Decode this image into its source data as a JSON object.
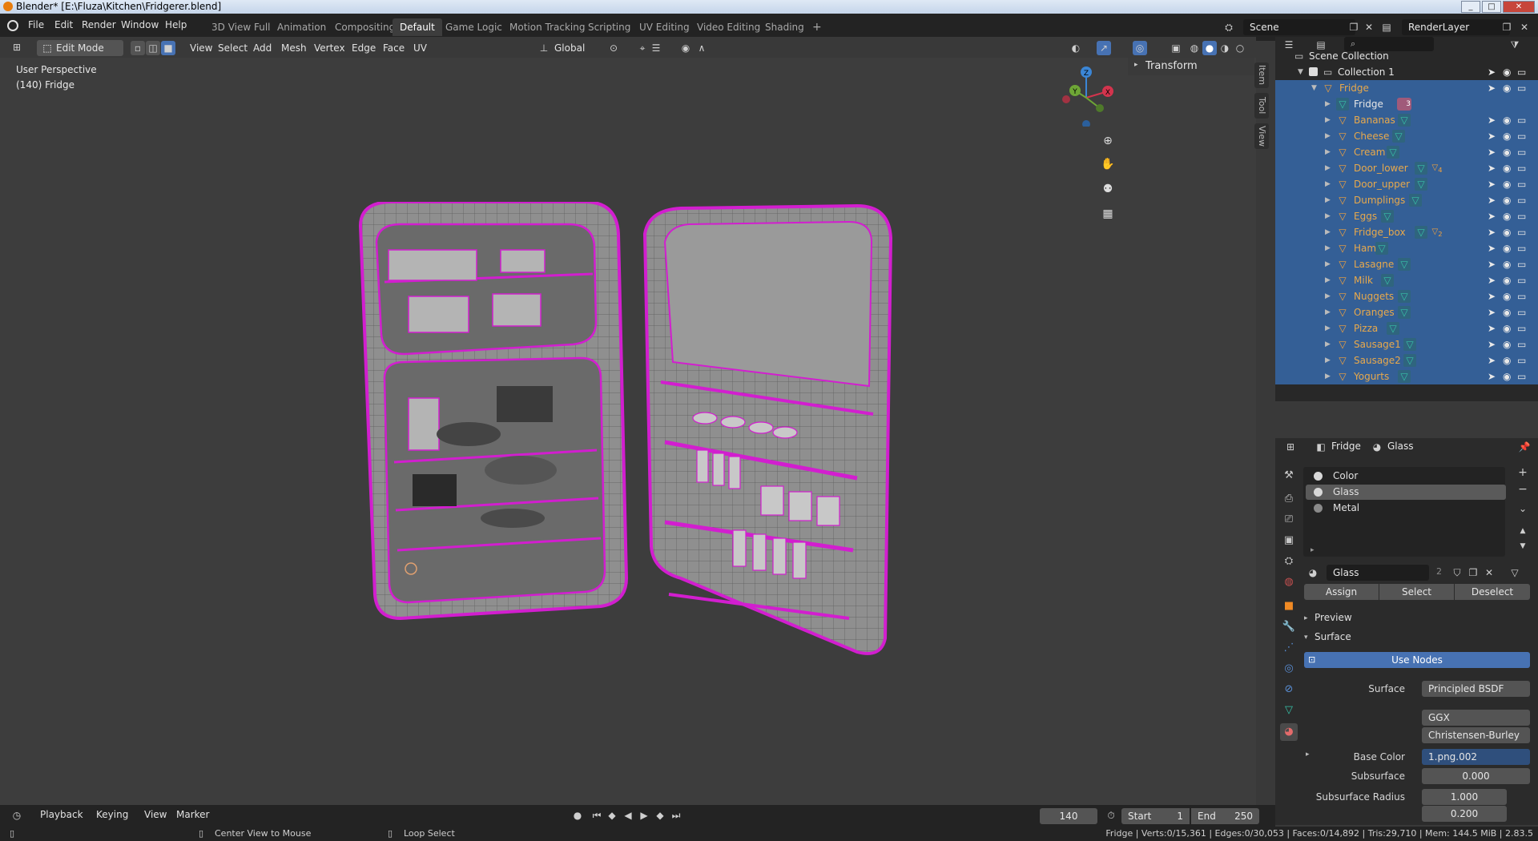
{
  "window": {
    "title": "Blender* [E:\\Fluza\\Kitchen\\Fridgerer.blend]",
    "min": "_",
    "max": "□",
    "close": "✕"
  },
  "menu": [
    "File",
    "Edit",
    "Render",
    "Window",
    "Help"
  ],
  "workspaces": [
    "3D View Full",
    "Animation",
    "Compositing",
    "Default",
    "Game Logic",
    "Motion Tracking",
    "Scripting",
    "UV Editing",
    "Video Editing",
    "Shading"
  ],
  "active_workspace": "Default",
  "add_tab": "+",
  "scene": {
    "label": "Scene",
    "value": "Scene"
  },
  "render_layer": "RenderLayer",
  "viewport_header": {
    "mode": "Edit Mode",
    "menus": [
      "View",
      "Select",
      "Add",
      "Mesh",
      "Vertex",
      "Edge",
      "Face",
      "UV"
    ],
    "transform_orientation": "Global"
  },
  "viewport": {
    "perspective": "User Perspective",
    "object_info": "(140) Fridge",
    "gizmo": {
      "x": "X",
      "y": "Y",
      "z": "Z"
    },
    "n_panel_header": "Transform",
    "side_tabs": [
      "Item",
      "Tool",
      "View"
    ]
  },
  "outliner": {
    "search_placeholder": "",
    "scene_collection": "Scene Collection",
    "collection": "Collection 1",
    "parent": "Fridge",
    "mesh_child": "Fridge",
    "mesh_child_badge": "3",
    "children": [
      {
        "name": "Bananas",
        "badge": ""
      },
      {
        "name": "Cheese",
        "badge": ""
      },
      {
        "name": "Cream",
        "badge": ""
      },
      {
        "name": "Door_lower",
        "badge": "4"
      },
      {
        "name": "Door_upper",
        "badge": ""
      },
      {
        "name": "Dumplings",
        "badge": ""
      },
      {
        "name": "Eggs",
        "badge": ""
      },
      {
        "name": "Fridge_box",
        "badge": "2"
      },
      {
        "name": "Ham",
        "badge": ""
      },
      {
        "name": "Lasagne",
        "badge": ""
      },
      {
        "name": "Milk",
        "badge": ""
      },
      {
        "name": "Nuggets",
        "badge": ""
      },
      {
        "name": "Oranges",
        "badge": ""
      },
      {
        "name": "Pizza",
        "badge": ""
      },
      {
        "name": "Sausage1",
        "badge": ""
      },
      {
        "name": "Sausage2",
        "badge": ""
      },
      {
        "name": "Yogurts",
        "badge": ""
      }
    ]
  },
  "properties": {
    "object": "Fridge",
    "material": "Glass",
    "slots": [
      "Color",
      "Glass",
      "Metal"
    ],
    "active_slot": "Glass",
    "material_field": "Glass",
    "users": "2",
    "assign": "Assign",
    "select": "Select",
    "deselect": "Deselect",
    "preview": "Preview",
    "surface_panel": "Surface",
    "use_nodes": "Use Nodes",
    "surface_label": "Surface",
    "surface_value": "Principled BSDF",
    "distribution": "GGX",
    "subsurface_method": "Christensen-Burley",
    "base_color_label": "Base Color",
    "base_color_value": "1.png.002",
    "subsurface_label": "Subsurface",
    "subsurface_value": "0.000",
    "subsurface_radius_label": "Subsurface Radius",
    "subsurface_radius_1": "1.000",
    "subsurface_radius_2": "0.200"
  },
  "timeline": {
    "menus": [
      "Playback",
      "Keying",
      "View",
      "Marker"
    ],
    "current_frame": "140",
    "start_label": "Start",
    "start": "1",
    "end_label": "End",
    "end": "250"
  },
  "statusbar": {
    "hint1": "Center View to Mouse",
    "hint2": "Loop Select",
    "stats": "Fridge | Verts:0/15,361 | Edges:0/30,053 | Faces:0/14,892 | Tris:29,710 | Mem: 144.5 MiB | 2.83.5"
  },
  "colors": {
    "accent": "#345f96",
    "selected_object": "#e8a94c",
    "wire_select": "#d21ecf",
    "header_bg": "#232323"
  }
}
